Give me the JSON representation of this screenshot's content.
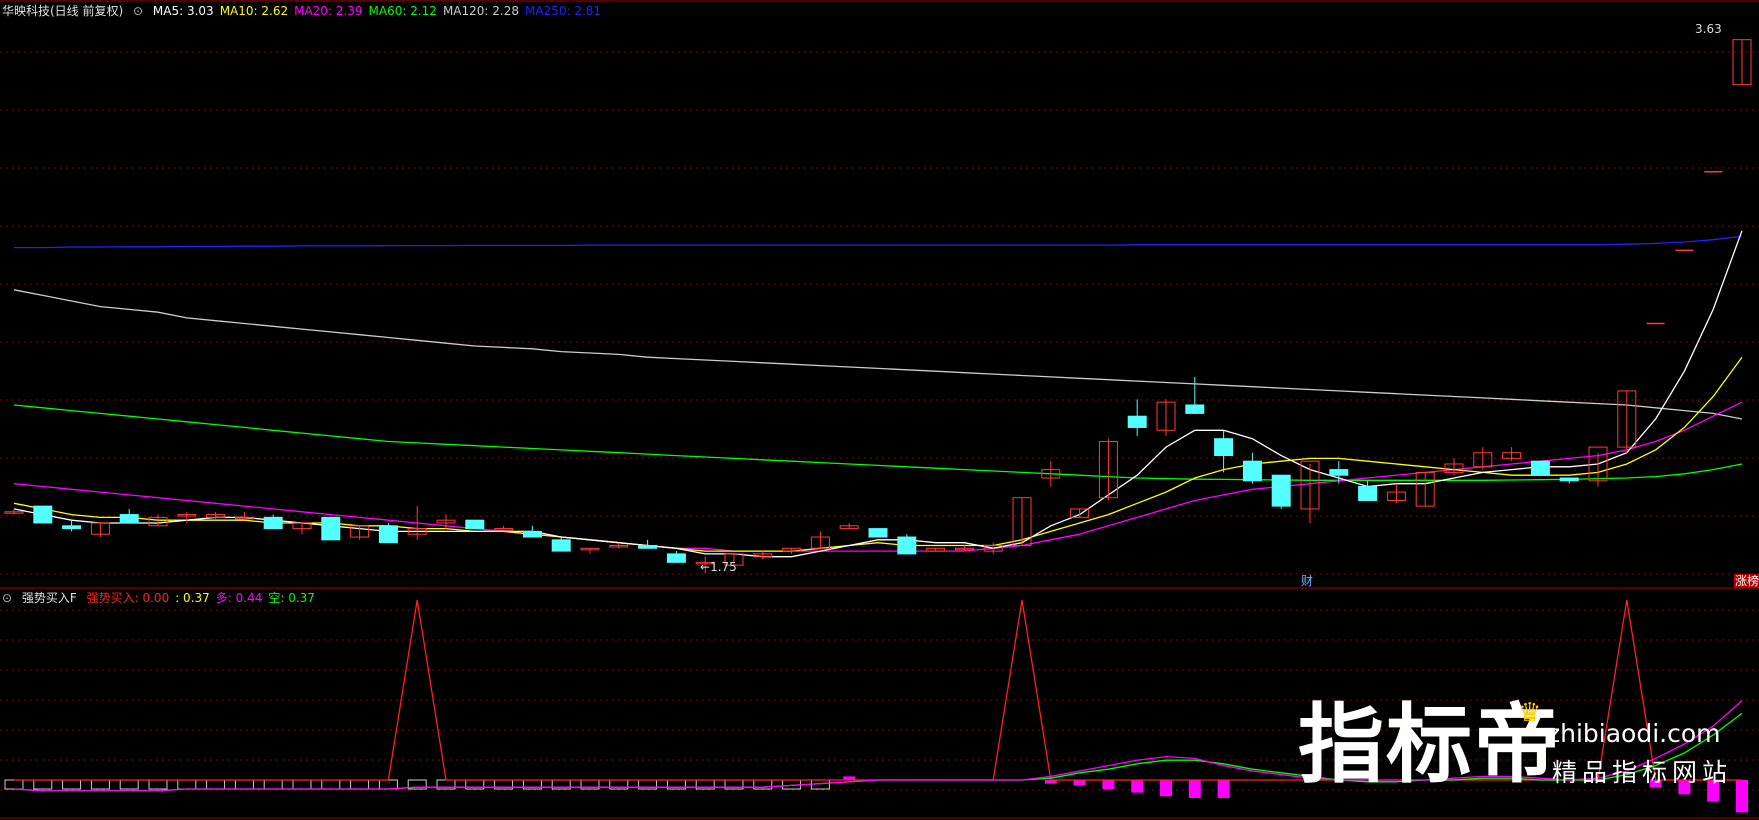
{
  "header": {
    "stock_name": "华映科技(日线 前复权)",
    "ma": [
      {
        "label": "MA5: 3.03",
        "color": "#ffffff"
      },
      {
        "label": "MA10: 2.62",
        "color": "#ffff00"
      },
      {
        "label": "MA20: 2.39",
        "color": "#ff00ff"
      },
      {
        "label": "MA60: 2.12",
        "color": "#00ff00"
      },
      {
        "label": "MA120: 2.28",
        "color": "#cccccc"
      },
      {
        "label": "MA250: 2.81",
        "color": "#2222ff"
      }
    ]
  },
  "indicator_header": {
    "name": "强势买入F",
    "items": [
      {
        "label": "强势买入: 0.00",
        "color": "#ff2020"
      },
      {
        "label": ": 0.37",
        "color": "#ffff00"
      },
      {
        "label": "多: 0.44",
        "color": "#ff00ff"
      },
      {
        "label": "空: 0.37",
        "color": "#00ff00"
      }
    ]
  },
  "annotations": {
    "high_label": "3.63",
    "low_label": "1.75",
    "fin_marker": "财",
    "limit_marker": "涨榜"
  },
  "watermark": {
    "big": "指标帝",
    "site": "zhibiaodi.com",
    "slogan": "精品指标网站"
  },
  "colors": {
    "up": "#ff3b3b",
    "down": "#54ffff",
    "grid": "#8b0000",
    "ma5": "#ffffff",
    "ma10": "#ffff00",
    "ma20": "#ff00ff",
    "ma60": "#00ff00",
    "ma120": "#cccccc",
    "ma250": "#2222ff"
  },
  "chart_data": [
    {
      "type": "candlestick",
      "title": "华映科技(日线 前复权)",
      "ylim": [
        1.7,
        3.7
      ],
      "ohlc": [
        [
          1.95,
          1.96,
          1.94,
          1.95
        ],
        [
          1.97,
          1.97,
          1.91,
          1.91
        ],
        [
          1.9,
          1.92,
          1.88,
          1.89
        ],
        [
          1.87,
          1.91,
          1.86,
          1.91
        ],
        [
          1.94,
          1.96,
          1.91,
          1.91
        ],
        [
          1.9,
          1.94,
          1.9,
          1.93
        ],
        [
          1.94,
          1.95,
          1.91,
          1.94
        ],
        [
          1.93,
          1.95,
          1.92,
          1.94
        ],
        [
          1.93,
          1.95,
          1.92,
          1.93
        ],
        [
          1.93,
          1.94,
          1.89,
          1.89
        ],
        [
          1.89,
          1.91,
          1.87,
          1.91
        ],
        [
          1.93,
          1.93,
          1.85,
          1.85
        ],
        [
          1.86,
          1.9,
          1.85,
          1.9
        ],
        [
          1.9,
          1.91,
          1.84,
          1.84
        ],
        [
          1.87,
          1.97,
          1.85,
          1.89
        ],
        [
          1.91,
          1.94,
          1.89,
          1.92
        ],
        [
          1.92,
          1.92,
          1.89,
          1.89
        ],
        [
          1.89,
          1.9,
          1.89,
          1.89
        ],
        [
          1.88,
          1.9,
          1.86,
          1.86
        ],
        [
          1.85,
          1.86,
          1.81,
          1.81
        ],
        [
          1.82,
          1.82,
          1.8,
          1.82
        ],
        [
          1.83,
          1.84,
          1.82,
          1.83
        ],
        [
          1.83,
          1.85,
          1.82,
          1.82
        ],
        [
          1.8,
          1.81,
          1.77,
          1.77
        ],
        [
          1.77,
          1.79,
          1.73,
          1.77
        ],
        [
          1.76,
          1.8,
          1.76,
          1.8
        ],
        [
          1.79,
          1.81,
          1.78,
          1.8
        ],
        [
          1.81,
          1.82,
          1.8,
          1.82
        ],
        [
          1.82,
          1.88,
          1.82,
          1.86
        ],
        [
          1.89,
          1.91,
          1.89,
          1.9
        ],
        [
          1.89,
          1.89,
          1.86,
          1.86
        ],
        [
          1.86,
          1.87,
          1.8,
          1.8
        ],
        [
          1.81,
          1.82,
          1.81,
          1.82
        ],
        [
          1.82,
          1.83,
          1.81,
          1.82
        ],
        [
          1.81,
          1.84,
          1.8,
          1.83
        ],
        [
          1.83,
          2.0,
          1.83,
          2.0
        ],
        [
          2.07,
          2.13,
          2.04,
          2.1
        ],
        [
          1.93,
          1.96,
          1.93,
          1.96
        ],
        [
          2.0,
          2.21,
          1.99,
          2.2
        ],
        [
          2.29,
          2.35,
          2.22,
          2.25
        ],
        [
          2.24,
          2.35,
          2.22,
          2.34
        ],
        [
          2.33,
          2.43,
          2.32,
          2.3
        ],
        [
          2.21,
          2.24,
          2.09,
          2.15
        ],
        [
          2.13,
          2.16,
          2.05,
          2.06
        ],
        [
          2.08,
          2.08,
          1.96,
          1.97
        ],
        [
          1.96,
          2.12,
          1.91,
          2.13
        ],
        [
          2.1,
          2.13,
          2.05,
          2.08
        ],
        [
          2.04,
          2.06,
          1.99,
          1.99
        ],
        [
          1.99,
          2.05,
          1.98,
          2.02
        ],
        [
          1.97,
          2.09,
          1.97,
          2.09
        ],
        [
          2.09,
          2.14,
          2.08,
          2.12
        ],
        [
          2.11,
          2.18,
          2.1,
          2.16
        ],
        [
          2.14,
          2.18,
          2.13,
          2.16
        ],
        [
          2.13,
          2.13,
          2.08,
          2.08
        ],
        [
          2.07,
          2.07,
          2.05,
          2.06
        ],
        [
          2.06,
          2.16,
          2.04,
          2.18
        ],
        [
          2.18,
          2.38,
          2.16,
          2.38
        ],
        [
          2.62,
          2.62,
          2.62,
          2.62
        ],
        [
          2.88,
          2.88,
          2.88,
          2.88
        ],
        [
          3.16,
          3.16,
          3.16,
          3.16
        ],
        [
          3.47,
          3.63,
          3.47,
          3.63
        ]
      ],
      "ma5": [
        1.96,
        1.94,
        1.92,
        1.91,
        1.91,
        1.91,
        1.92,
        1.93,
        1.93,
        1.92,
        1.91,
        1.9,
        1.89,
        1.88,
        1.88,
        1.88,
        1.88,
        1.88,
        1.88,
        1.86,
        1.85,
        1.84,
        1.83,
        1.82,
        1.8,
        1.8,
        1.79,
        1.79,
        1.81,
        1.83,
        1.85,
        1.85,
        1.84,
        1.84,
        1.82,
        1.84,
        1.9,
        1.94,
        2.01,
        2.08,
        2.18,
        2.24,
        2.24,
        2.21,
        2.15,
        2.1,
        2.07,
        2.04,
        2.05,
        2.05,
        2.07,
        2.09,
        2.1,
        2.11,
        2.11,
        2.12,
        2.16,
        2.28,
        2.45,
        2.67,
        2.95
      ],
      "ma10": [
        1.98,
        1.96,
        1.94,
        1.93,
        1.93,
        1.92,
        1.92,
        1.92,
        1.92,
        1.91,
        1.91,
        1.91,
        1.9,
        1.9,
        1.89,
        1.89,
        1.88,
        1.88,
        1.87,
        1.86,
        1.85,
        1.84,
        1.83,
        1.82,
        1.81,
        1.81,
        1.81,
        1.81,
        1.82,
        1.83,
        1.84,
        1.83,
        1.83,
        1.83,
        1.83,
        1.85,
        1.88,
        1.91,
        1.94,
        1.98,
        2.02,
        2.07,
        2.1,
        2.12,
        2.13,
        2.14,
        2.14,
        2.13,
        2.12,
        2.11,
        2.1,
        2.09,
        2.08,
        2.08,
        2.08,
        2.09,
        2.12,
        2.17,
        2.25,
        2.36,
        2.5
      ],
      "ma20": [
        2.05,
        2.04,
        2.03,
        2.02,
        2.01,
        2.0,
        1.99,
        1.98,
        1.97,
        1.96,
        1.95,
        1.94,
        1.93,
        1.92,
        1.91,
        1.9,
        1.89,
        1.88,
        1.87,
        1.86,
        1.85,
        1.84,
        1.83,
        1.82,
        1.82,
        1.81,
        1.81,
        1.81,
        1.81,
        1.81,
        1.81,
        1.81,
        1.81,
        1.81,
        1.82,
        1.83,
        1.85,
        1.87,
        1.9,
        1.93,
        1.96,
        1.99,
        2.01,
        2.03,
        2.04,
        2.05,
        2.06,
        2.07,
        2.08,
        2.09,
        2.1,
        2.11,
        2.12,
        2.13,
        2.14,
        2.15,
        2.17,
        2.2,
        2.24,
        2.29,
        2.34
      ],
      "ma60": [
        2.33,
        2.32,
        2.31,
        2.3,
        2.29,
        2.28,
        2.27,
        2.26,
        2.25,
        2.24,
        2.23,
        2.22,
        2.21,
        2.2,
        2.195,
        2.19,
        2.185,
        2.18,
        2.175,
        2.17,
        2.165,
        2.16,
        2.155,
        2.15,
        2.145,
        2.14,
        2.135,
        2.13,
        2.125,
        2.12,
        2.115,
        2.11,
        2.105,
        2.1,
        2.095,
        2.09,
        2.085,
        2.08,
        2.075,
        2.07,
        2.068,
        2.066,
        2.065,
        2.064,
        2.063,
        2.062,
        2.062,
        2.062,
        2.062,
        2.062,
        2.062,
        2.062,
        2.063,
        2.064,
        2.065,
        2.068,
        2.07,
        2.075,
        2.085,
        2.1,
        2.12
      ],
      "ma120": [
        2.74,
        2.72,
        2.7,
        2.68,
        2.67,
        2.66,
        2.64,
        2.63,
        2.62,
        2.61,
        2.6,
        2.59,
        2.58,
        2.57,
        2.56,
        2.55,
        2.54,
        2.535,
        2.53,
        2.52,
        2.515,
        2.51,
        2.5,
        2.495,
        2.49,
        2.485,
        2.48,
        2.475,
        2.47,
        2.465,
        2.46,
        2.455,
        2.45,
        2.445,
        2.44,
        2.435,
        2.43,
        2.425,
        2.42,
        2.415,
        2.41,
        2.405,
        2.4,
        2.395,
        2.39,
        2.385,
        2.38,
        2.375,
        2.37,
        2.365,
        2.36,
        2.355,
        2.35,
        2.345,
        2.34,
        2.335,
        2.33,
        2.32,
        2.31,
        2.3,
        2.28
      ],
      "ma250": [
        2.89,
        2.89,
        2.892,
        2.892,
        2.893,
        2.893,
        2.894,
        2.894,
        2.895,
        2.895,
        2.896,
        2.896,
        2.896,
        2.897,
        2.897,
        2.897,
        2.898,
        2.898,
        2.898,
        2.898,
        2.899,
        2.899,
        2.899,
        2.899,
        2.899,
        2.899,
        2.899,
        2.899,
        2.899,
        2.899,
        2.899,
        2.899,
        2.899,
        2.899,
        2.899,
        2.899,
        2.899,
        2.899,
        2.899,
        2.9,
        2.9,
        2.9,
        2.9,
        2.9,
        2.9,
        2.9,
        2.9,
        2.9,
        2.9,
        2.9,
        2.9,
        2.9,
        2.9,
        2.9,
        2.9,
        2.9,
        2.902,
        2.905,
        2.91,
        2.918,
        2.93
      ]
    },
    {
      "type": "line",
      "title": "强势买入F",
      "ylim": [
        -0.2,
        1.0
      ],
      "signal": [
        0,
        0,
        0,
        0,
        0,
        0,
        0,
        0,
        0,
        0,
        0,
        0,
        0,
        0,
        1,
        0,
        0,
        0,
        0,
        0,
        0,
        0,
        0,
        0,
        0,
        0,
        0,
        0,
        0,
        0,
        0,
        0,
        0,
        0,
        0,
        1,
        0,
        0,
        0,
        0,
        0,
        0,
        0,
        0,
        0,
        0,
        0,
        0,
        0,
        0,
        0,
        0,
        0,
        0,
        0,
        0,
        1,
        0,
        0,
        0,
        0
      ],
      "duo": [
        -0.05,
        -0.06,
        -0.06,
        -0.06,
        -0.06,
        -0.06,
        -0.05,
        -0.05,
        -0.05,
        -0.05,
        -0.05,
        -0.05,
        -0.05,
        -0.05,
        -0.04,
        -0.04,
        -0.04,
        -0.04,
        -0.04,
        -0.04,
        -0.04,
        -0.04,
        -0.04,
        -0.04,
        -0.04,
        -0.04,
        -0.04,
        -0.03,
        -0.02,
        -0.01,
        0.0,
        0.0,
        0.0,
        0.0,
        0.0,
        0.0,
        0.02,
        0.05,
        0.08,
        0.11,
        0.13,
        0.12,
        0.08,
        0.05,
        0.03,
        0.01,
        0.0,
        0.0,
        0.0,
        0.0,
        0.01,
        0.02,
        0.02,
        0.01,
        0.0,
        0.01,
        0.05,
        0.12,
        0.2,
        0.3,
        0.44
      ],
      "kong": [
        -0.05,
        -0.06,
        -0.06,
        -0.06,
        -0.06,
        -0.06,
        -0.05,
        -0.05,
        -0.05,
        -0.05,
        -0.05,
        -0.05,
        -0.05,
        -0.05,
        -0.04,
        -0.04,
        -0.04,
        -0.04,
        -0.04,
        -0.04,
        -0.04,
        -0.04,
        -0.04,
        -0.04,
        -0.04,
        -0.04,
        -0.04,
        -0.03,
        -0.02,
        -0.01,
        0.0,
        0.0,
        0.0,
        0.0,
        0.0,
        0.0,
        0.01,
        0.04,
        0.06,
        0.09,
        0.11,
        0.11,
        0.09,
        0.06,
        0.04,
        0.02,
        0.0,
        -0.01,
        -0.01,
        0.0,
        0.0,
        0.01,
        0.01,
        0.0,
        0.0,
        0.0,
        0.03,
        0.08,
        0.15,
        0.25,
        0.37
      ],
      "bars": [
        -0.05,
        -0.05,
        -0.05,
        -0.05,
        -0.05,
        -0.05,
        -0.05,
        -0.05,
        -0.05,
        -0.05,
        -0.05,
        -0.05,
        -0.05,
        -0.05,
        -0.05,
        -0.05,
        -0.05,
        -0.05,
        -0.05,
        -0.05,
        -0.05,
        -0.05,
        -0.05,
        -0.05,
        -0.05,
        -0.05,
        -0.05,
        -0.05,
        -0.05,
        0.02,
        0.0,
        0.0,
        0.0,
        0.0,
        0.0,
        0.0,
        -0.02,
        -0.03,
        -0.05,
        -0.07,
        -0.09,
        -0.1,
        -0.1,
        0.0,
        0.0,
        0.0,
        0.0,
        0.0,
        0.0,
        0.0,
        0.0,
        0.0,
        0.0,
        0.0,
        0.0,
        0.0,
        0.0,
        -0.04,
        -0.08,
        -0.12,
        -0.18
      ]
    }
  ]
}
